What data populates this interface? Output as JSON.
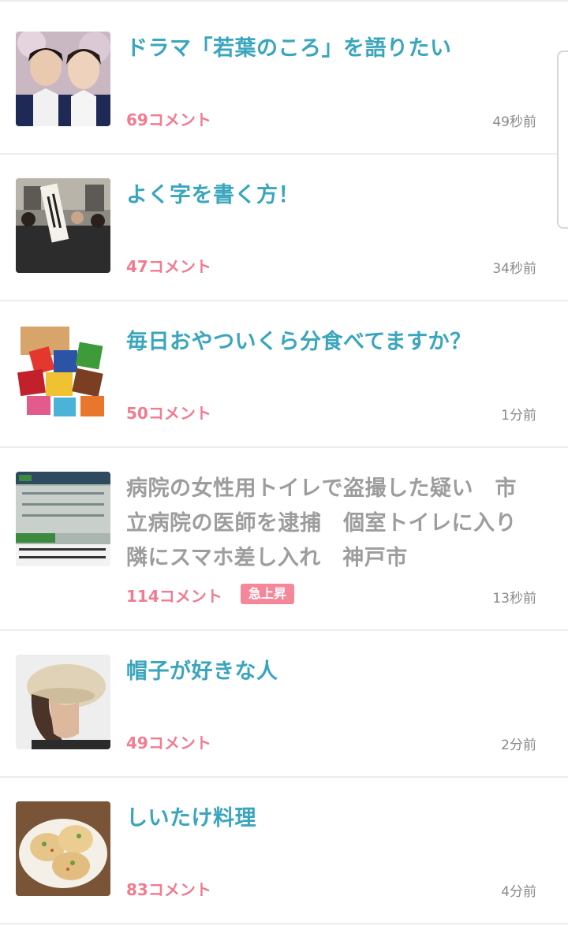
{
  "topics": [
    {
      "title": "ドラマ「若葉のころ」を語りたい",
      "comments": "69コメント",
      "time": "49秒前",
      "read": false,
      "badge": null,
      "image": "two-young-men-photo"
    },
    {
      "title": "よく字を書く方！",
      "comments": "47コメント",
      "time": "34秒前",
      "read": false,
      "badge": null,
      "image": "courthouse-banner-photo"
    },
    {
      "title": "毎日おやついくら分食べてますか？",
      "comments": "50コメント",
      "time": "1分前",
      "read": false,
      "badge": null,
      "image": "snack-bags-photo"
    },
    {
      "title": "病院の女性用トイレで盗撮した疑い　市立病院の医師を逮捕　個室トイレに入り隣にスマホ差し入れ　神戸市",
      "comments": "114コメント",
      "time": "13秒前",
      "read": true,
      "badge": "急上昇",
      "image": "hospital-news-screenshot"
    },
    {
      "title": "帽子が好きな人",
      "comments": "49コメント",
      "time": "2分前",
      "read": false,
      "badge": null,
      "image": "beret-hat-photo"
    },
    {
      "title": "しいたけ料理",
      "comments": "83コメント",
      "time": "4分前",
      "read": false,
      "badge": null,
      "image": "stuffed-mushroom-dish-photo"
    }
  ],
  "colors": {
    "title": "#3aa6bd",
    "title_read": "#9d9d9d",
    "comments": "#f27b8f",
    "badge_bg": "#f4889a",
    "time": "#8a8a8a",
    "divider": "#ececec"
  }
}
